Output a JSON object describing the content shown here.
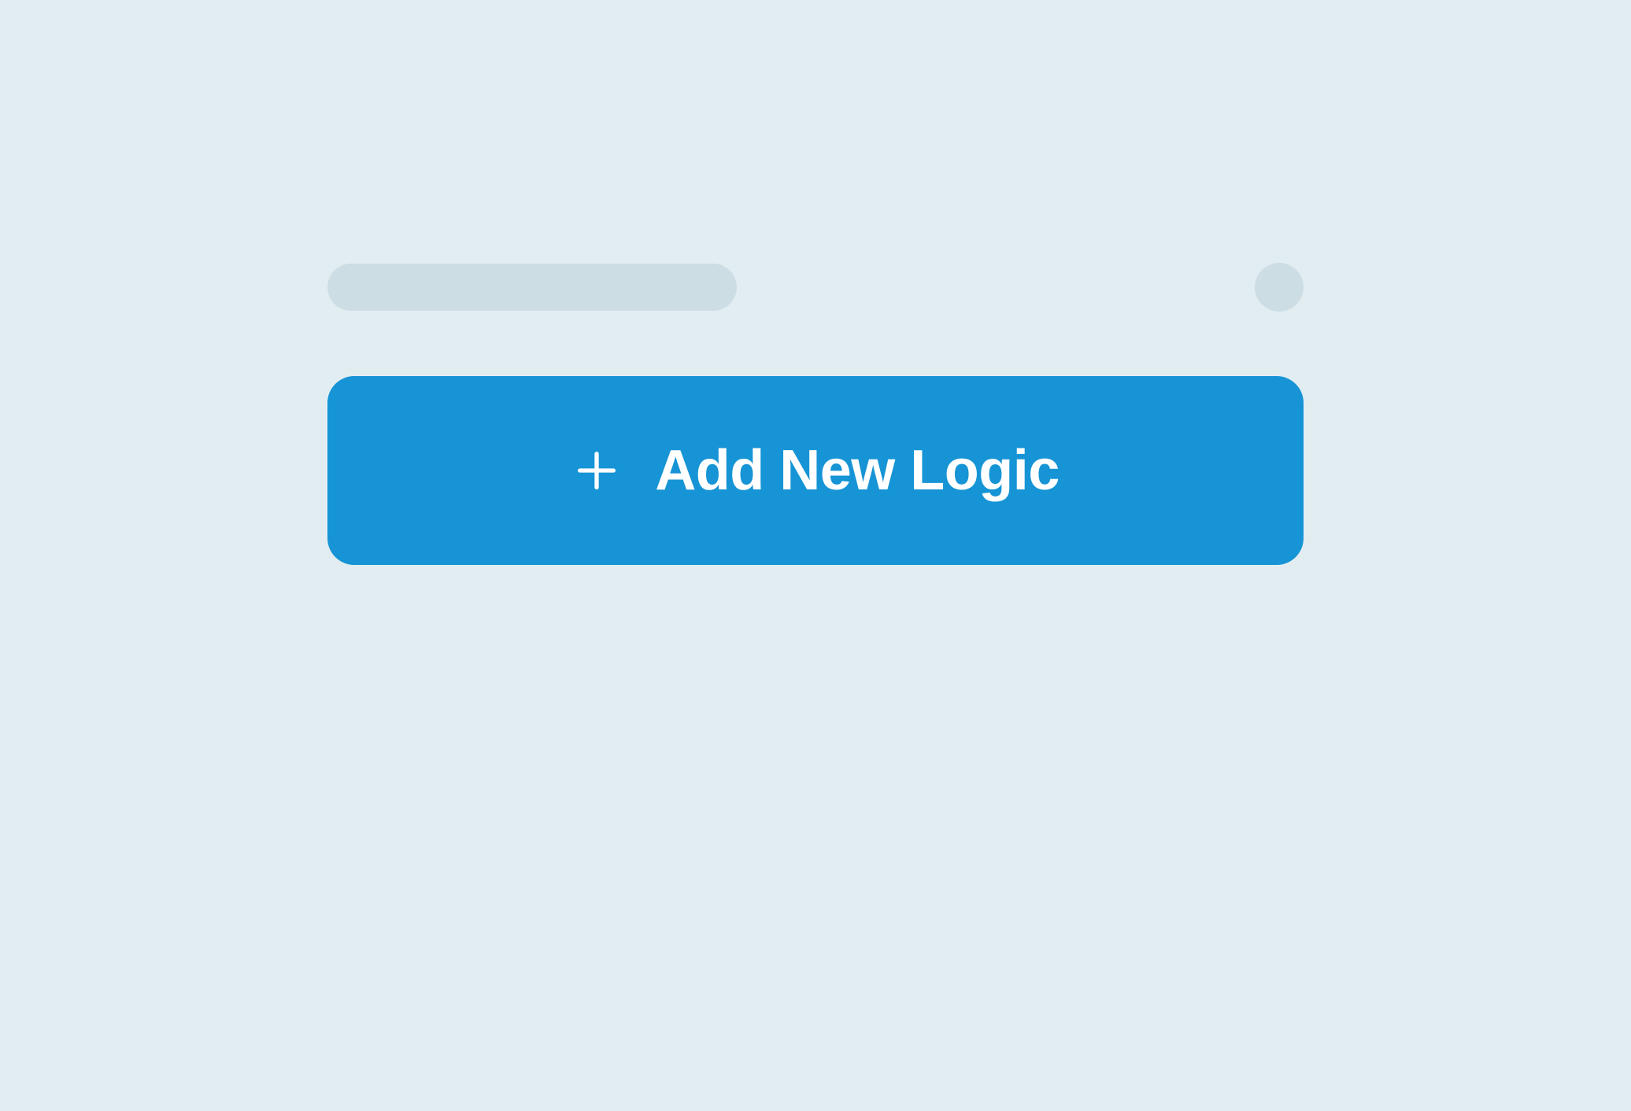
{
  "button": {
    "add_logic_label": "Add New Logic"
  },
  "colors": {
    "background": "#e2edf2",
    "skeleton": "#cddde4",
    "button_primary": "#1694d5",
    "button_text": "#ffffff"
  }
}
